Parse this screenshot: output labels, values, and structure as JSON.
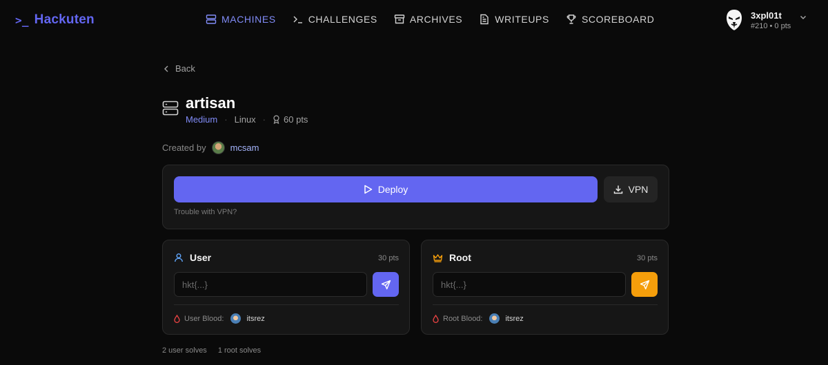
{
  "header": {
    "logo_prompt": ">_",
    "logo_text": "Hackuten",
    "nav": [
      {
        "label": "MACHINES",
        "icon": "server-icon",
        "active": true
      },
      {
        "label": "CHALLENGES",
        "icon": "terminal-icon",
        "active": false
      },
      {
        "label": "ARCHIVES",
        "icon": "archive-icon",
        "active": false
      },
      {
        "label": "WRITEUPS",
        "icon": "document-icon",
        "active": false
      },
      {
        "label": "SCOREBOARD",
        "icon": "trophy-icon",
        "active": false
      }
    ],
    "user": {
      "name": "3xpl01t",
      "meta": "#210 • 0 pts"
    }
  },
  "back_label": "Back",
  "machine": {
    "name": "artisan",
    "difficulty": "Medium",
    "os": "Linux",
    "points": "60 pts",
    "created_by_label": "Created by",
    "creator": "mcsam"
  },
  "deploy": {
    "deploy_label": "Deploy",
    "vpn_label": "VPN",
    "trouble_label": "Trouble with VPN?"
  },
  "flags": {
    "user": {
      "title": "User",
      "points": "30 pts",
      "placeholder": "hkt{...}",
      "blood_label": "User Blood:",
      "blood_user": "itsrez"
    },
    "root": {
      "title": "Root",
      "points": "30 pts",
      "placeholder": "hkt{...}",
      "blood_label": "Root Blood:",
      "blood_user": "itsrez"
    }
  },
  "solves": {
    "user": "2 user solves",
    "root": "1 root solves"
  },
  "colors": {
    "accent": "#6366f1",
    "root_accent": "#f59e0b",
    "background": "#0a0a0a",
    "panel": "#161616",
    "blood": "#ef4444"
  }
}
